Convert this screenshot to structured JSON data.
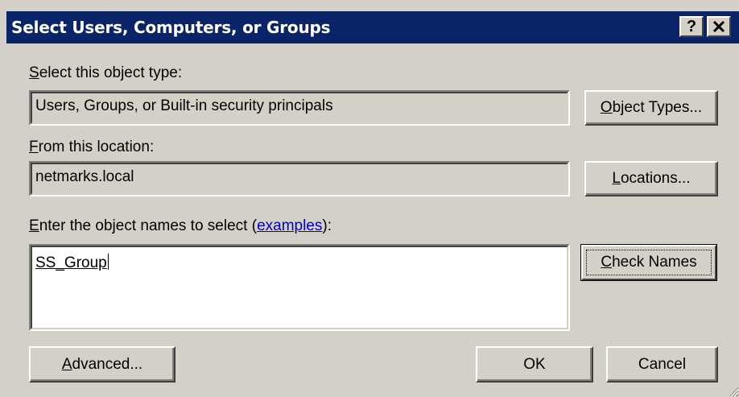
{
  "window": {
    "title": "Select Users, Computers, or Groups",
    "help_icon": "help-icon",
    "close_icon": "close-icon"
  },
  "object_type": {
    "label_access": "S",
    "label_rest": "elect this object type:",
    "value": "Users, Groups, or Built-in security principals",
    "button_access": "O",
    "button_rest": "bject Types..."
  },
  "location": {
    "label_access": "F",
    "label_rest": "rom this location:",
    "value": "netmarks.local",
    "button_access": "L",
    "button_rest": "ocations..."
  },
  "names": {
    "label_access": "E",
    "label_rest": "nter the object names to select (",
    "examples_link": "examples",
    "label_end": "):",
    "value": "SS_Group",
    "check_access": "C",
    "check_rest": "heck Names"
  },
  "footer": {
    "advanced_access": "A",
    "advanced_rest": "dvanced...",
    "ok_label": "OK",
    "cancel_label": "Cancel"
  }
}
